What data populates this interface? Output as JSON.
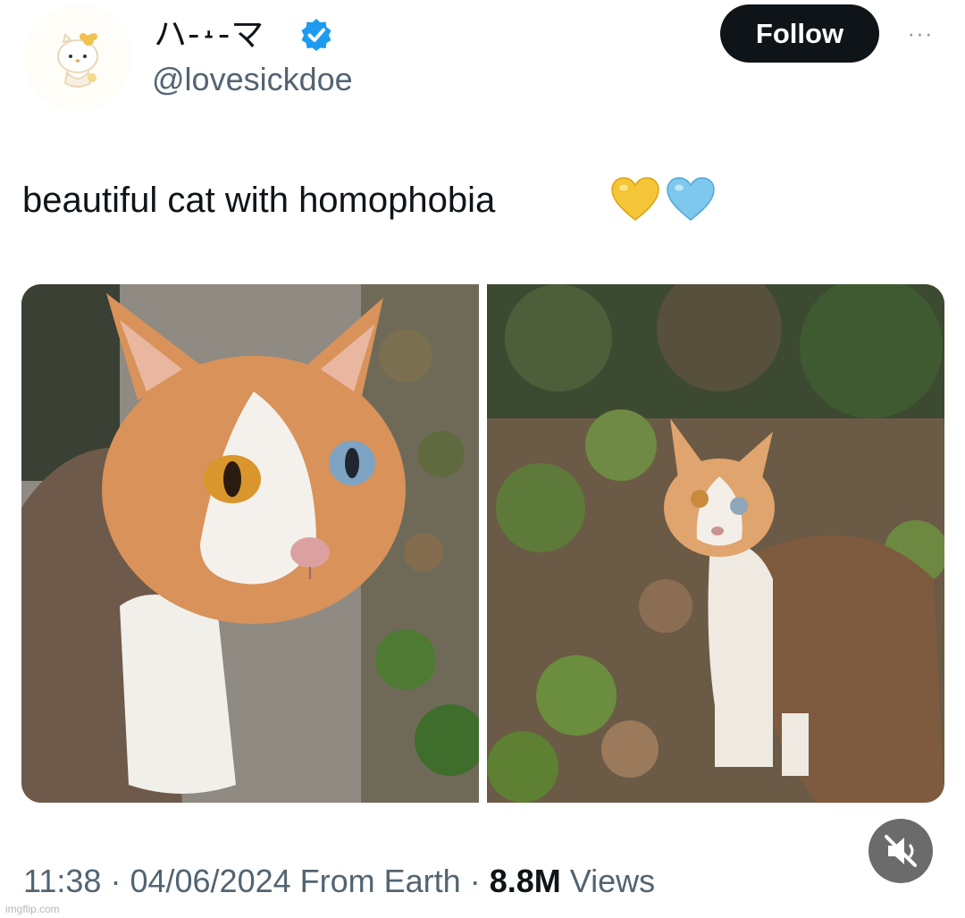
{
  "author": {
    "display_name": "ハ-˔-マ",
    "handle": "@lovesickdoe",
    "avatar_icon": "hello-kitty-avatar-icon",
    "verified_icon": "verified-badge-icon",
    "verified_color": "#1d9bf0"
  },
  "header": {
    "follow_label": "Follow",
    "more_label": "···"
  },
  "tweet": {
    "text": "beautiful cat with homophobia",
    "emojis": [
      "yellow-heart-icon",
      "light-blue-heart-icon"
    ]
  },
  "media": {
    "images": [
      "cat-closeup-photo",
      "cat-in-garden-photo"
    ],
    "mute_icon": "muted-speaker-icon"
  },
  "meta": {
    "time": "11:38",
    "sep1": "·",
    "date": "04/06/2024",
    "source": "From Earth",
    "sep2": "·",
    "views_count": "8.8M",
    "views_label": "Views"
  },
  "watermark": "imgflip.com"
}
